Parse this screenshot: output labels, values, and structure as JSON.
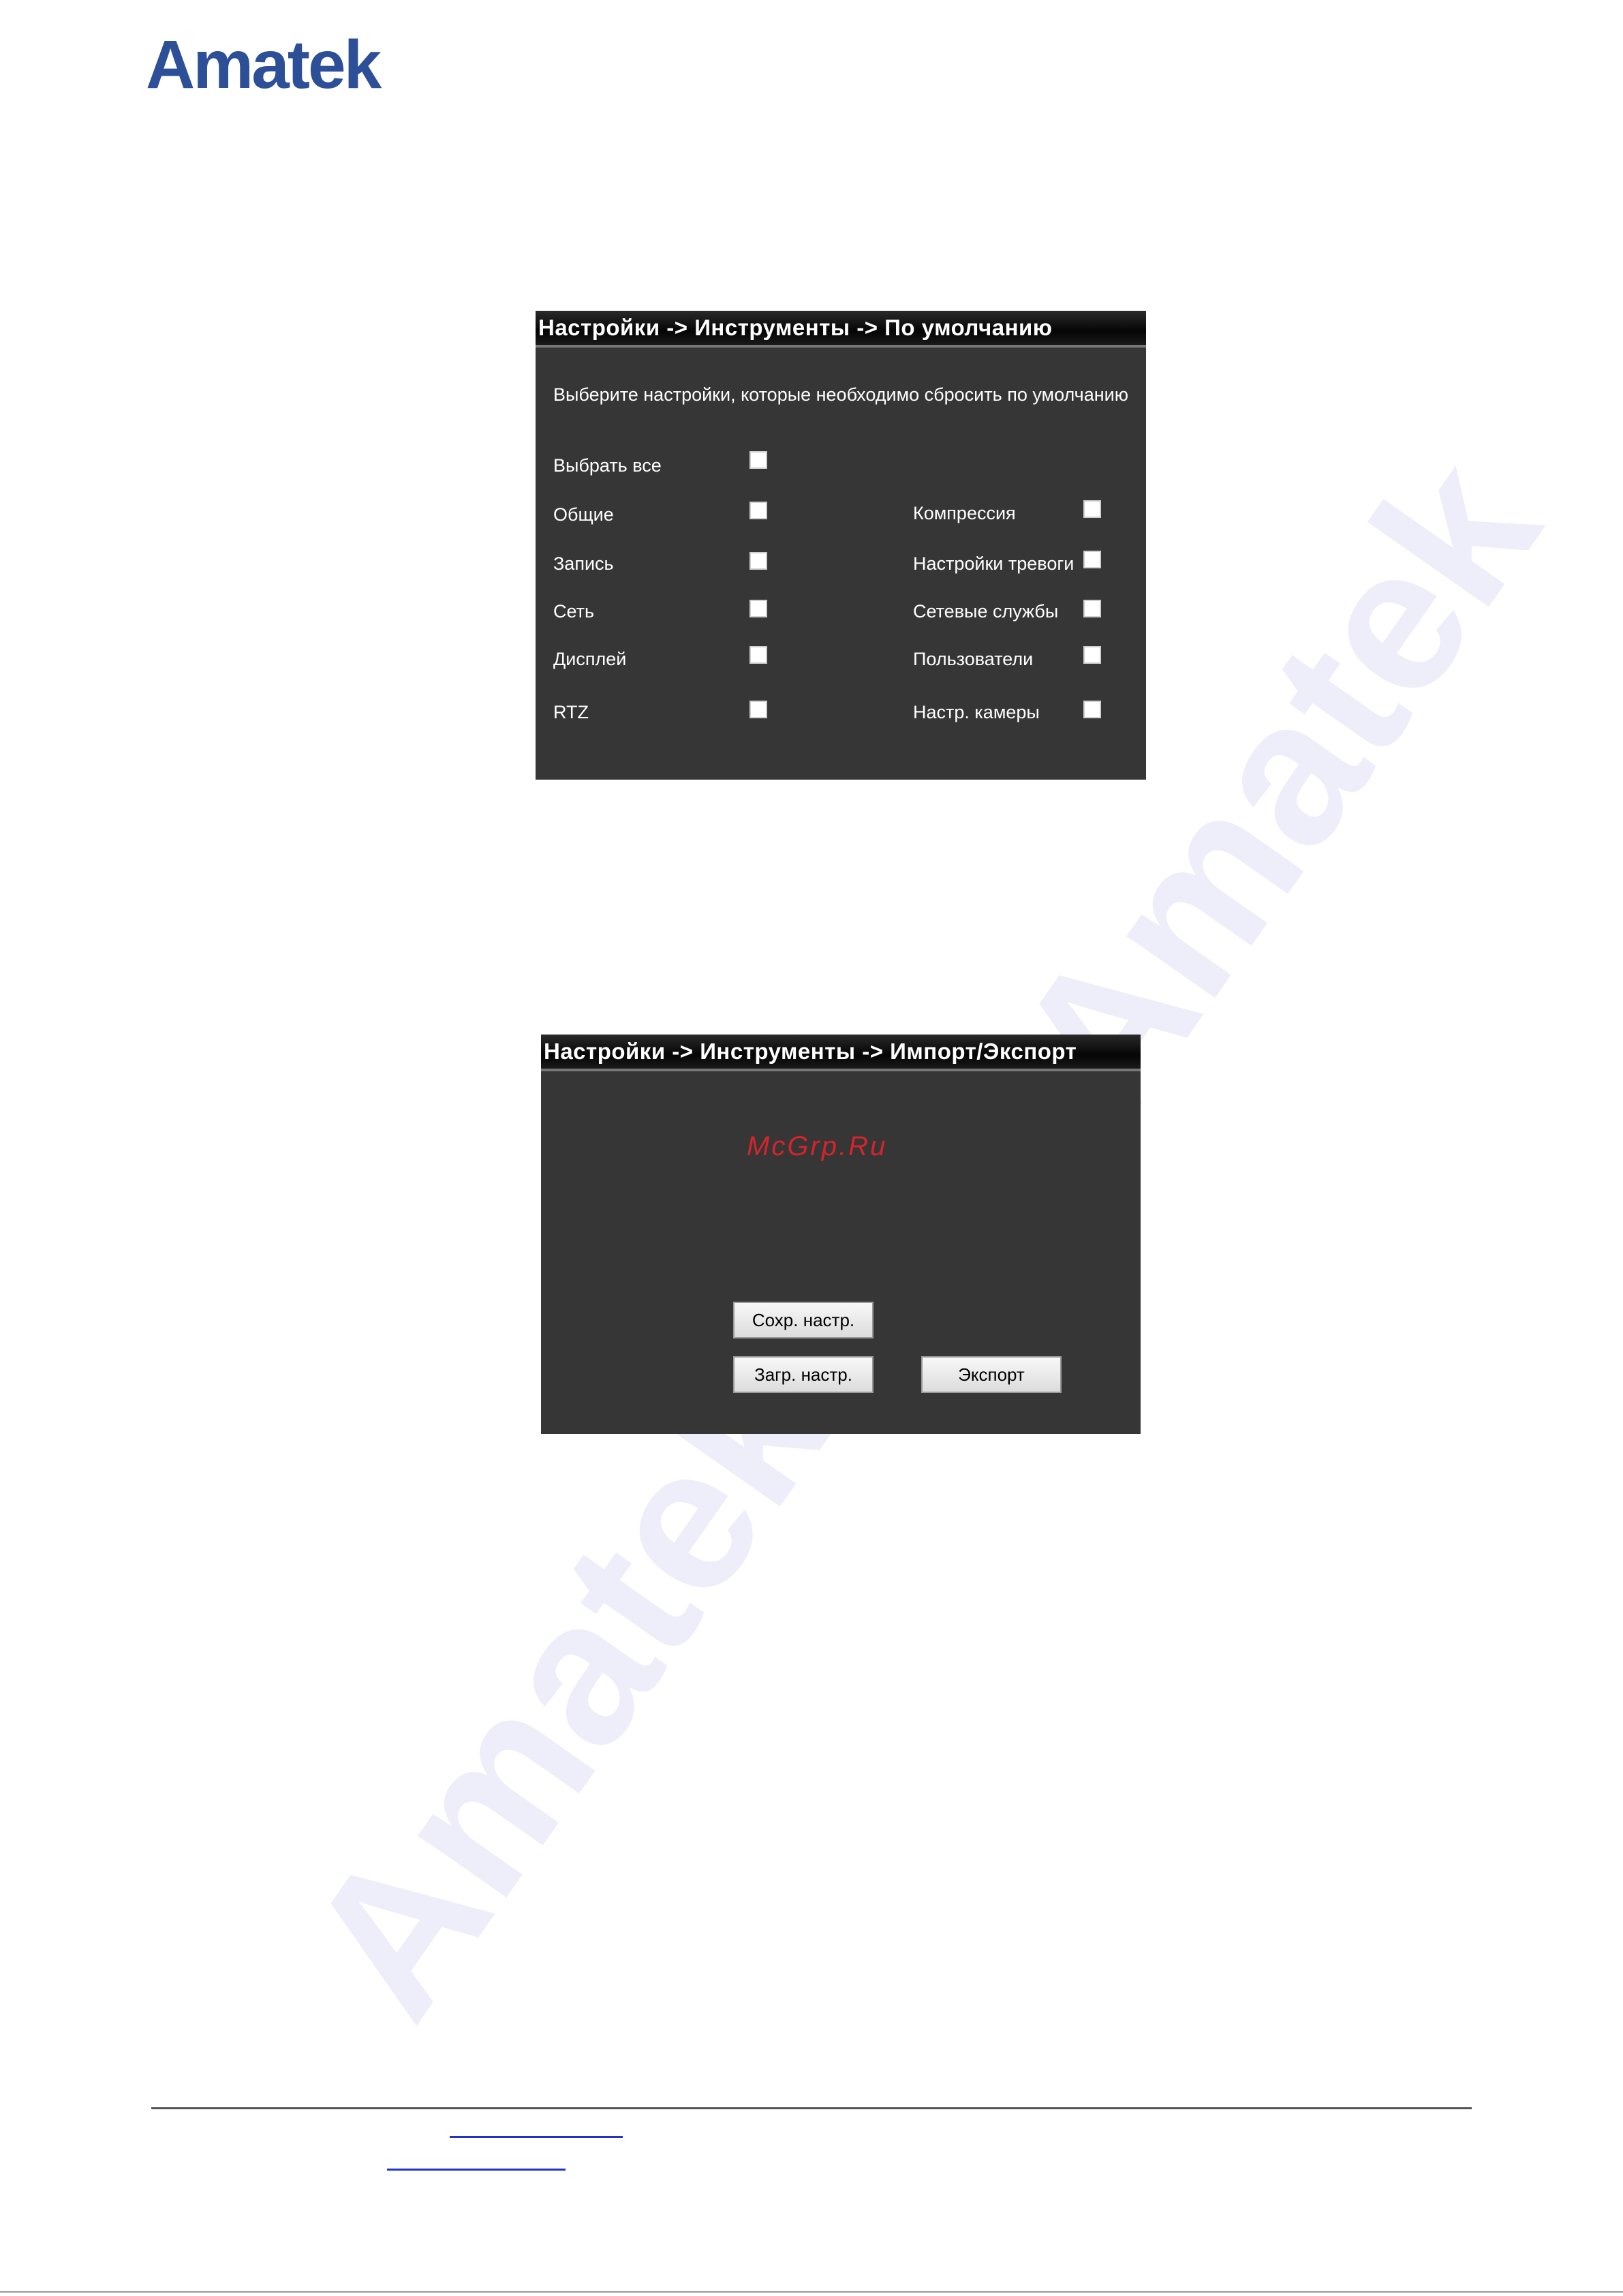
{
  "logo": "Amatek",
  "watermark": "Amatek",
  "panel_defaults": {
    "title": "Настройки -> Инструменты -> По умолчанию",
    "intro": "Выберите настройки, которые необходимо сбросить по умолчанию",
    "select_all": "Выбрать все",
    "left_options": [
      "Общие",
      "Запись",
      "Сеть",
      "Дисплей",
      "RTZ"
    ],
    "right_options": [
      "Компрессия",
      "Настройки тревоги",
      "Сетевые службы",
      "Пользователи",
      "Настр. камеры"
    ],
    "checked": false
  },
  "panel_import_export": {
    "title": "Настройки -> Инструменты -> Импорт/Экспорт",
    "overlay_text": "McGrp.Ru",
    "save_button": "Сохр. настр.",
    "load_button": "Загр. настр.",
    "export_button": "Экспорт"
  },
  "colors": {
    "logo": "#2c4f97",
    "panel_bg": "#363636",
    "watermark": "#eeeefa",
    "overlay_text": "#d6242b"
  }
}
